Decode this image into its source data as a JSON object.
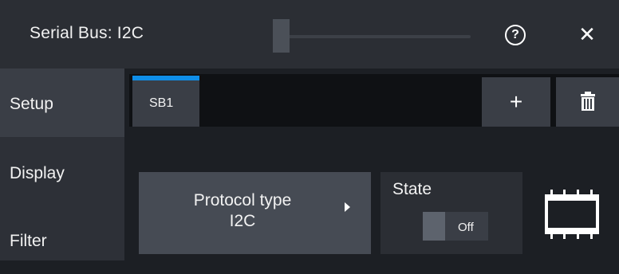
{
  "window": {
    "title": "Serial Bus: I2C",
    "help_icon": "help-circle-icon",
    "close_icon": "close-icon",
    "help_glyph": "?",
    "close_glyph": "✕"
  },
  "sidebar": {
    "items": [
      {
        "label": "Setup",
        "active": true
      },
      {
        "label": "Display",
        "active": false
      },
      {
        "label": "Filter",
        "active": false
      }
    ]
  },
  "tabs": {
    "items": [
      {
        "label": "SB1",
        "active": true
      }
    ],
    "add_glyph": "+",
    "add_icon": "plus-icon",
    "delete_icon": "trash-icon",
    "accent_color": "#0f8ee8"
  },
  "protocol": {
    "label": "Protocol type",
    "value": "I2C"
  },
  "state": {
    "label": "State",
    "toggle_text": "Off",
    "on": false
  },
  "device_icon": "chip-icon"
}
